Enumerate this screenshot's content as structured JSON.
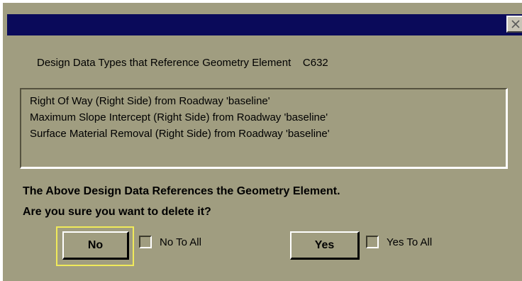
{
  "dialog": {
    "header_label": "Design Data Types that Reference Geometry Element    C632",
    "close_icon": "close-icon",
    "references": [
      "Right Of Way (Right Side) from Roadway 'baseline'",
      "Maximum Slope Intercept (Right Side) from Roadway 'baseline'",
      "Surface Material Removal (Right Side) from Roadway 'baseline'"
    ],
    "warning_line1": "The Above Design Data References the Geometry Element.",
    "warning_line2": "Are you sure you want to delete it?",
    "no_label": "No",
    "no_to_all_label": "No To All",
    "yes_label": "Yes",
    "yes_to_all_label": "Yes To All",
    "no_to_all_checked": false,
    "yes_to_all_checked": false
  },
  "colors": {
    "dialog_face": "#a09d80",
    "titlebar": "#0a0a5a",
    "focus_ring": "#f0ea5a"
  }
}
